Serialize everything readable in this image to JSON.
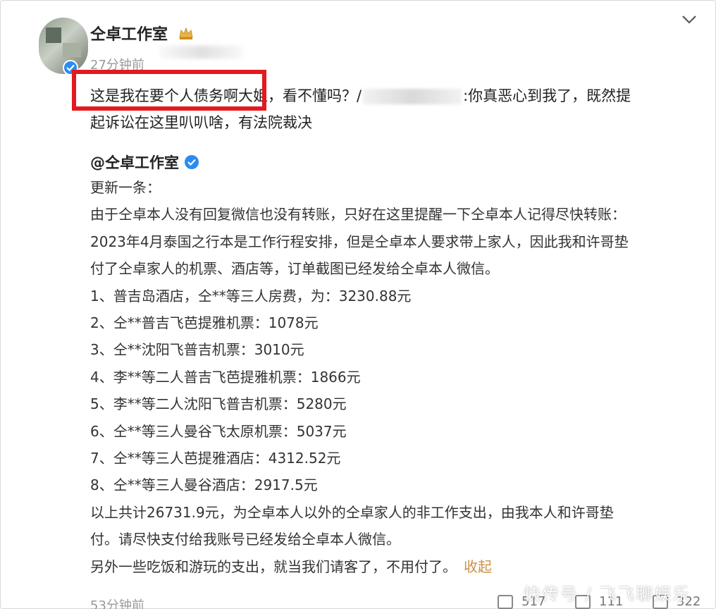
{
  "post": {
    "author": "仝卓工作室",
    "time": "27分钟前",
    "text_line1_a": "这是我在要个人债务啊大姐，看不懂吗？/",
    "text_line1_b": ":你真恶心到我了，既然提",
    "text_line2": "起诉讼在这里叭叭啥，有法院裁决"
  },
  "quoted": {
    "author": "@仝卓工作室",
    "lines": [
      "更新一条：",
      "由于仝卓本人没有回复微信也没有转账，只好在这里提醒一下仝卓本人记得尽快转账：",
      "2023年4月泰国之行本是工作行程安排，但是仝卓本人要求带上家人，因此我和许哥垫",
      "付了仝卓家人的机票、酒店等，订单截图已经发给仝卓本人微信。",
      "1、普吉岛酒店，仝**等三人房费，为：3230.88元",
      "2、仝**普吉飞芭提雅机票：1078元",
      "3、仝**沈阳飞普吉机票：3010元",
      "4、李**等二人普吉飞芭提雅机票：1866元",
      "5、李**等二人沈阳飞普吉机票：5280元",
      "6、仝**等三人曼谷飞太原机票：5037元",
      "7、仝**等三人芭提雅酒店：4312.52元",
      "8、仝**等三人曼谷酒店：2917.5元",
      "以上共计26731.9元，为仝卓本人以外的仝卓家人的非工作支出，由我本人和许哥垫",
      "付。请尽快支付给我账号已经发给仝卓本人微信。"
    ],
    "last_line": "另外一些吃饭和游玩的支出，就当我们请客了，不用付了。",
    "collapse_label": "收起"
  },
  "footer": {
    "time": "53分钟前",
    "repost_count": "517",
    "comment_count": "111",
    "like_count": "322"
  },
  "watermark": "快传号 / 飞飞聊娱乐",
  "colors": {
    "highlight_box": "#e3191f",
    "verified": "#2a8cf0",
    "collapse_link": "#c8924a"
  }
}
